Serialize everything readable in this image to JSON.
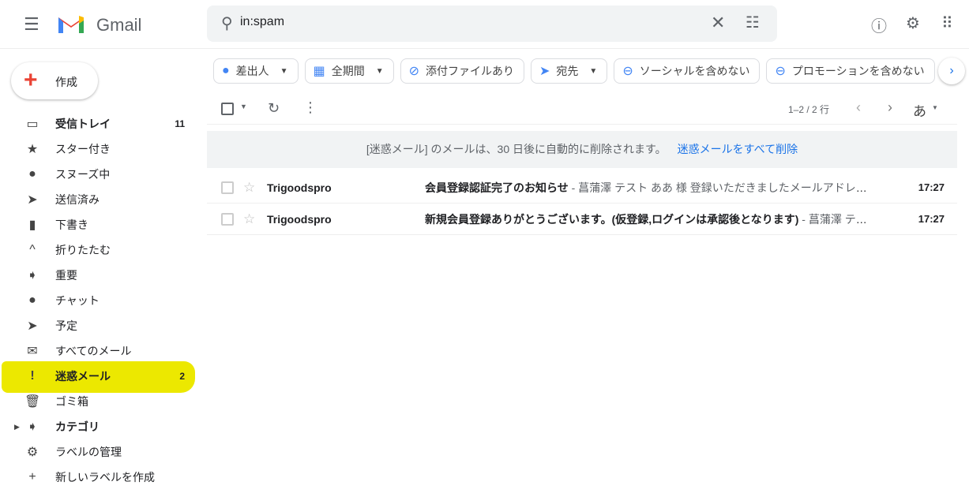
{
  "header": {
    "app_name": "Gmail",
    "search_value": "in:spam",
    "icons": [
      "menu-icon",
      "search-icon",
      "clear-icon",
      "tune-icon",
      "help-icon",
      "settings-icon",
      "apps-icon"
    ]
  },
  "compose": {
    "label": "作成"
  },
  "sidebar": {
    "items": [
      {
        "label": "受信トレイ",
        "count": "11",
        "icon": "inbox-icon",
        "glyph": "▭",
        "bold": true
      },
      {
        "label": "スター付き",
        "icon": "star-icon",
        "glyph": "★"
      },
      {
        "label": "スヌーズ中",
        "icon": "clock-icon",
        "glyph": "●"
      },
      {
        "label": "送信済み",
        "icon": "send-icon",
        "glyph": "➤"
      },
      {
        "label": "下書き",
        "icon": "draft-icon",
        "glyph": "▮"
      },
      {
        "label": "折りたたむ",
        "icon": "chevron-up-icon",
        "glyph": "^"
      },
      {
        "label": "重要",
        "icon": "important-icon",
        "glyph": "➧"
      },
      {
        "label": "チャット",
        "icon": "chat-icon",
        "glyph": "●"
      },
      {
        "label": "予定",
        "icon": "scheduled-icon",
        "glyph": "➤"
      },
      {
        "label": "すべてのメール",
        "icon": "mail-icon",
        "glyph": "✉"
      },
      {
        "label": "迷惑メール",
        "count": "2",
        "icon": "spam-icon",
        "glyph": "!",
        "bold": true,
        "highlight": true
      },
      {
        "label": "ゴミ箱",
        "icon": "trash-icon",
        "glyph": "🗑"
      },
      {
        "label": "カテゴリ",
        "icon": "label-icon",
        "glyph": "➧",
        "bold": true,
        "caret": true
      },
      {
        "label": "ラベルの管理",
        "icon": "gear-icon",
        "glyph": "⚙"
      },
      {
        "label": "新しいラベルを作成",
        "icon": "plus-icon",
        "glyph": "+"
      }
    ]
  },
  "filters": [
    {
      "label": "差出人",
      "icon": "person-icon",
      "glyph": "●",
      "dropdown": true
    },
    {
      "label": "全期間",
      "icon": "calendar-icon",
      "glyph": "▦",
      "dropdown": true
    },
    {
      "label": "添付ファイルあり",
      "icon": "attachment-icon",
      "glyph": "⊘"
    },
    {
      "label": "宛先",
      "icon": "send-icon",
      "glyph": "➤",
      "dropdown": true
    },
    {
      "label": "ソーシャルを含めない",
      "icon": "minus-circle-icon",
      "glyph": "⊖"
    },
    {
      "label": "プロモーションを含めない",
      "icon": "minus-circle-icon",
      "glyph": "⊖"
    }
  ],
  "toolbar": {
    "pagination": "1–2 / 2 行",
    "input_tool": "あ"
  },
  "banner": {
    "text": "[迷惑メール] のメールは、30 日後に自動的に削除されます。",
    "action": "迷惑メールをすべて削除"
  },
  "emails": [
    {
      "from": "Trigoodspro",
      "subject": "会員登録認証完了のお知らせ",
      "snippet": " - 菖蒲澤 テスト ああ 様 登録いただきましたメールアドレスの認証が完了しました",
      "time": "17:27"
    },
    {
      "from": "Trigoodspro",
      "subject": "新規会員登録ありがとうございます。(仮登録,ログインは承認後となります)",
      "snippet": " - 菖蒲澤 テスト",
      "time": "17:27"
    }
  ],
  "colors": {
    "highlight": "#ece800",
    "link": "#1a73e8"
  }
}
